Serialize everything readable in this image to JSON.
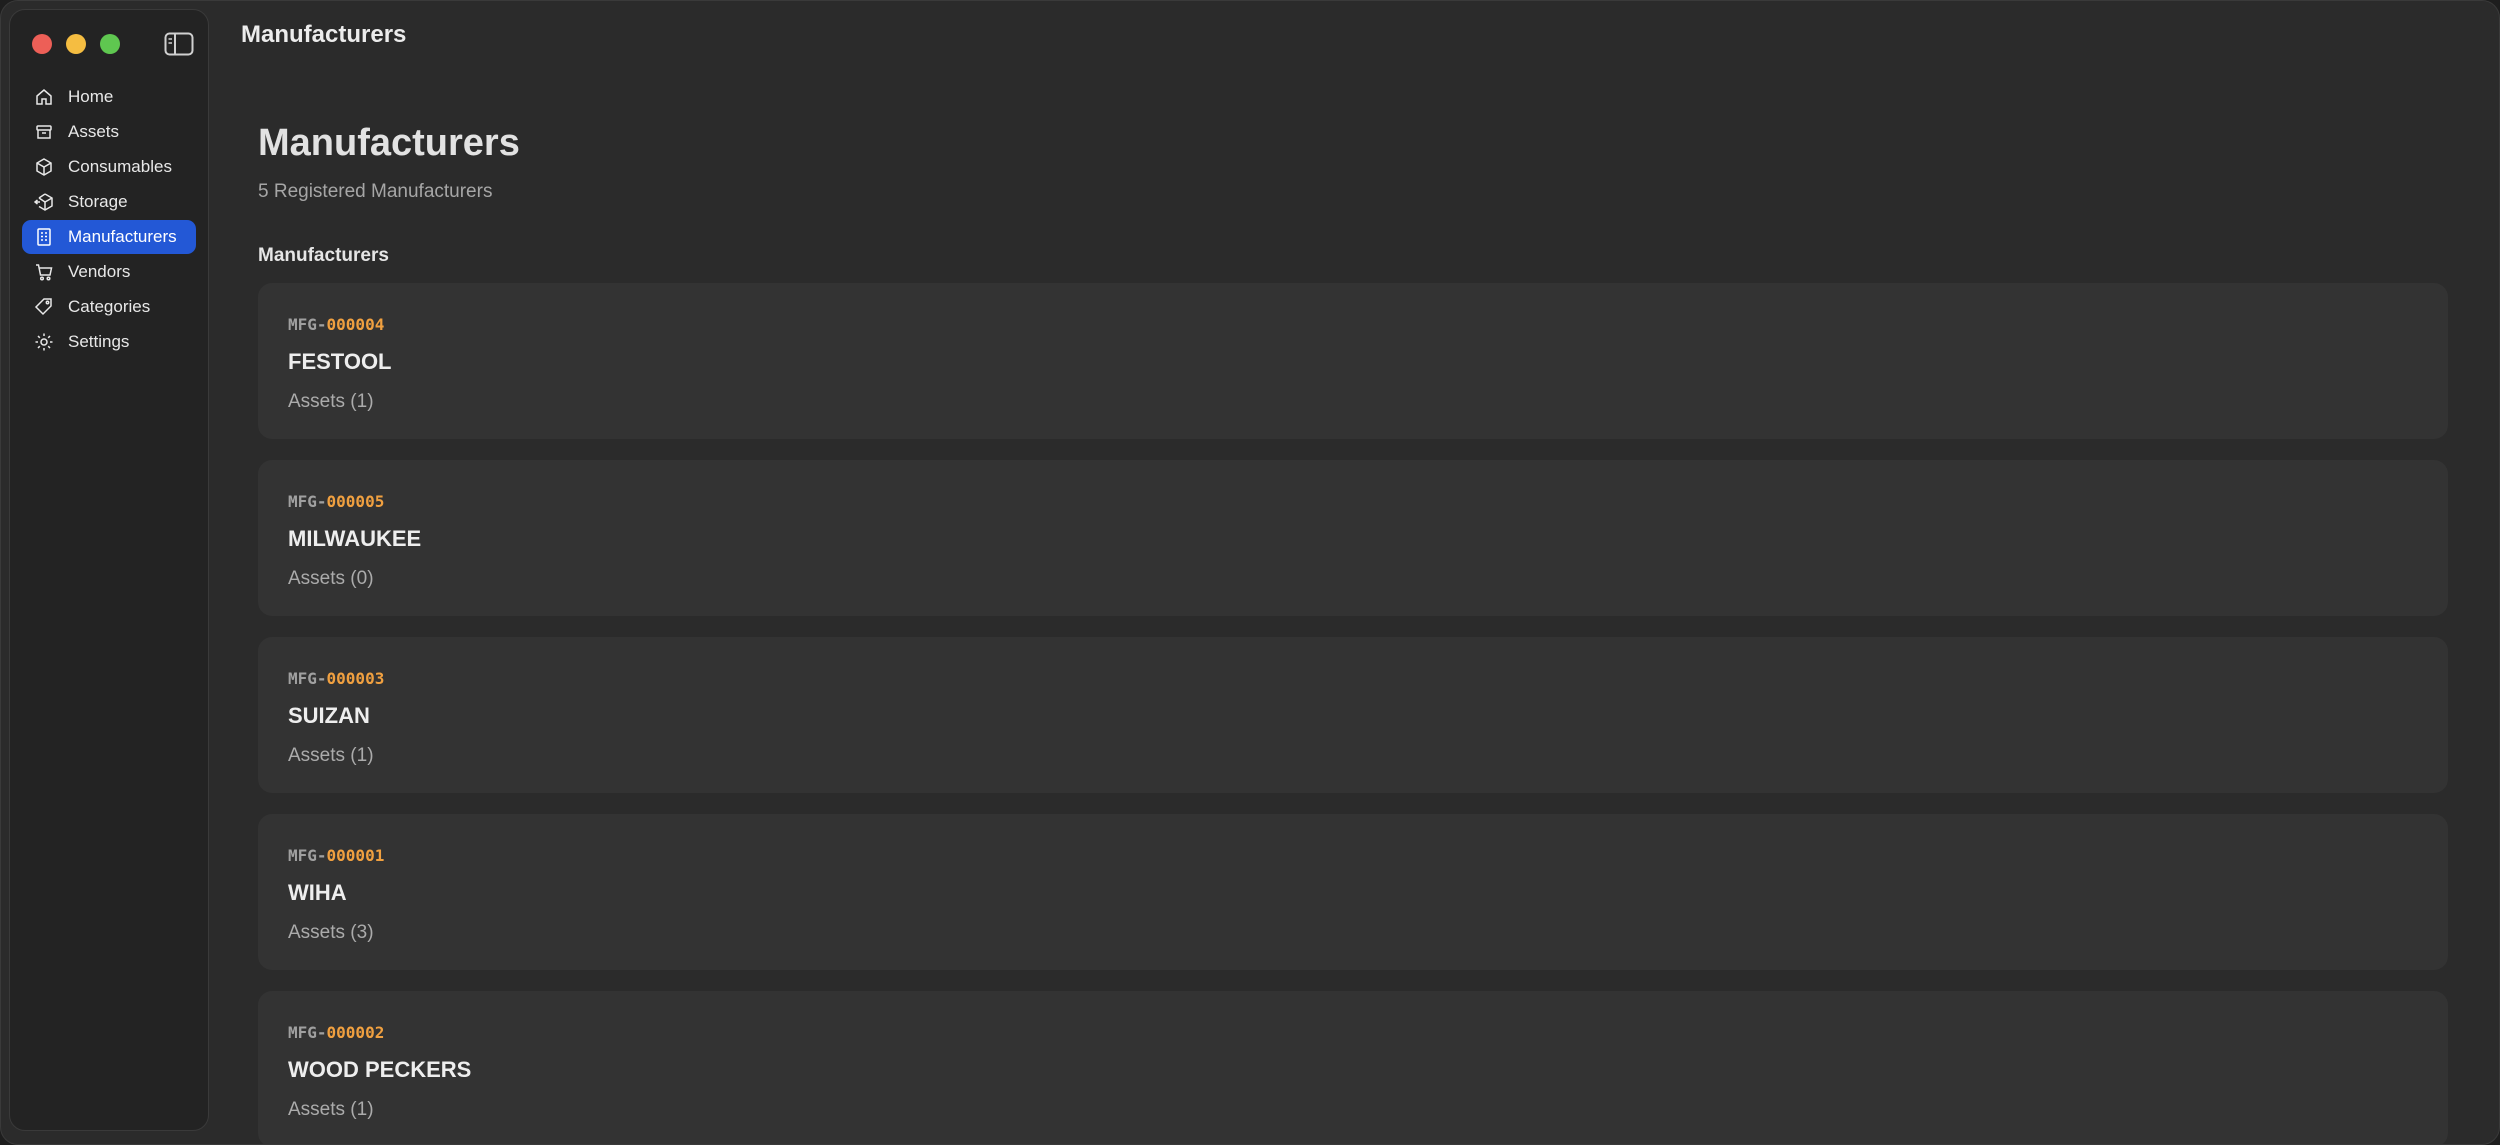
{
  "window": {
    "title": "Manufacturers"
  },
  "sidebar": {
    "items": [
      {
        "label": "Home",
        "icon": "house-icon"
      },
      {
        "label": "Assets",
        "icon": "archive-box-icon"
      },
      {
        "label": "Consumables",
        "icon": "cube-icon"
      },
      {
        "label": "Storage",
        "icon": "cube-arrow-icon"
      },
      {
        "label": "Manufacturers",
        "icon": "building-icon",
        "active": true
      },
      {
        "label": "Vendors",
        "icon": "cart-icon"
      },
      {
        "label": "Categories",
        "icon": "tag-icon"
      },
      {
        "label": "Settings",
        "icon": "gear-icon"
      }
    ]
  },
  "main": {
    "title": "Manufacturers",
    "subtitle": "5 Registered Manufacturers",
    "section_title": "Manufacturers",
    "manufacturers": [
      {
        "id_prefix": "MFG-",
        "id_number": "000004",
        "name": "FESTOOL",
        "assets": "Assets (1)"
      },
      {
        "id_prefix": "MFG-",
        "id_number": "000005",
        "name": "MILWAUKEE",
        "assets": "Assets (0)"
      },
      {
        "id_prefix": "MFG-",
        "id_number": "000003",
        "name": "SUIZAN",
        "assets": "Assets (1)"
      },
      {
        "id_prefix": "MFG-",
        "id_number": "000001",
        "name": "WIHA",
        "assets": "Assets (3)"
      },
      {
        "id_prefix": "MFG-",
        "id_number": "000002",
        "name": "WOOD PECKERS",
        "assets": "Assets (1)"
      }
    ]
  },
  "colors": {
    "accent": "#2358d6",
    "id_number": "#f0a040",
    "close": "#ed5f57",
    "minimize": "#f5bd41",
    "zoom": "#5fc750"
  }
}
